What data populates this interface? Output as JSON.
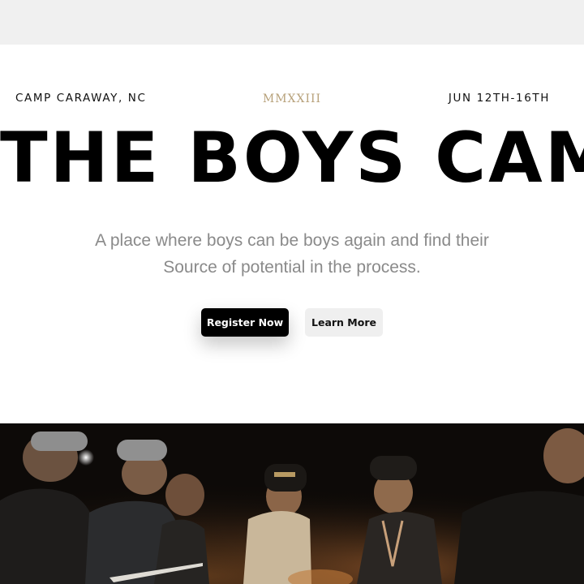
{
  "header": {
    "location": "CAMP CARAWAY, NC",
    "year": "MMXXIII",
    "dates": "JUN 12TH-16TH"
  },
  "hero": {
    "title": "THE BOYS CAMP",
    "tagline": "A place where boys can be boys again and find their Source of potential in the process."
  },
  "actions": {
    "register_label": "Register Now",
    "learn_more_label": "Learn More"
  },
  "photo": {
    "description_icon": "campfire-photo"
  },
  "colors": {
    "accent_gold": "#b7a17a",
    "primary_button": "#000000",
    "secondary_button": "#efefef",
    "tagline_gray": "#8a8a8a",
    "top_bar": "#f0f0f0"
  }
}
